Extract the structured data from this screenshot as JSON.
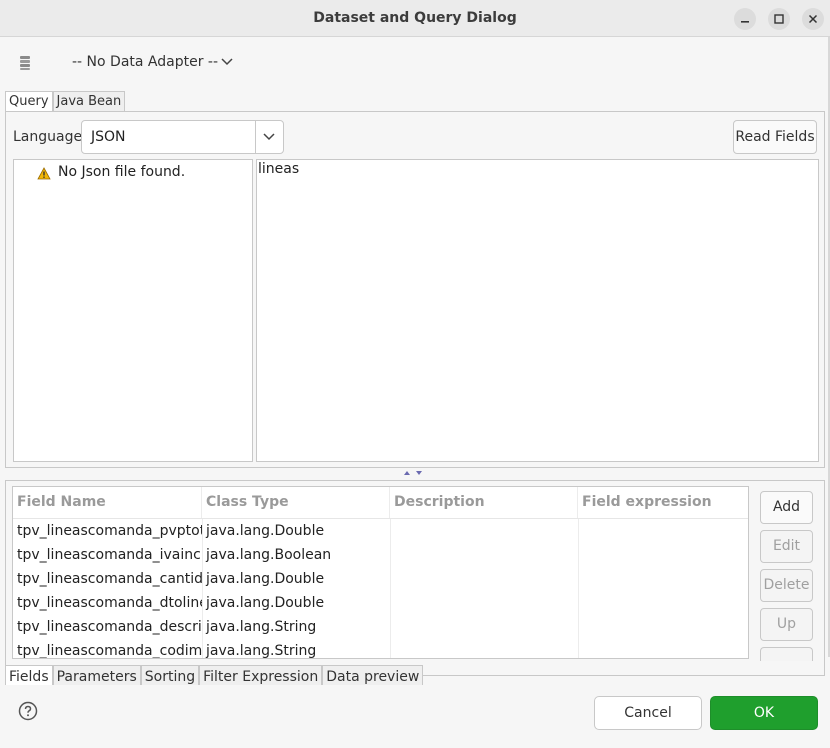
{
  "window": {
    "title": "Dataset and Query Dialog",
    "controls": [
      "minimize-icon",
      "maximize-icon",
      "close-icon"
    ]
  },
  "adapter": {
    "icon": "database-icon",
    "value": "-- No Data Adapter --"
  },
  "top_tabs": [
    {
      "label": "Query",
      "active": true
    },
    {
      "label": "Java Bean",
      "active": false
    }
  ],
  "query": {
    "language_label": "Language",
    "language_value": "JSON",
    "read_fields_label": "Read Fields",
    "tree_message": "No Json file found.",
    "query_text": "lineas"
  },
  "fields_table": {
    "columns": [
      "Field Name",
      "Class Type",
      "Description",
      "Field expression"
    ],
    "rows": [
      {
        "name": "tpv_lineascomanda_pvptot",
        "class": "java.lang.Double",
        "description": "",
        "expression": ""
      },
      {
        "name": "tpv_lineascomanda_ivaincl",
        "class": "java.lang.Boolean",
        "description": "",
        "expression": ""
      },
      {
        "name": "tpv_lineascomanda_cantida",
        "class": "java.lang.Double",
        "description": "",
        "expression": ""
      },
      {
        "name": "tpv_lineascomanda_dtoline",
        "class": "java.lang.Double",
        "description": "",
        "expression": ""
      },
      {
        "name": "tpv_lineascomanda_descrip",
        "class": "java.lang.String",
        "description": "",
        "expression": ""
      },
      {
        "name": "tpv_lineascomanda_codimp",
        "class": "java.lang.String",
        "description": "",
        "expression": ""
      }
    ]
  },
  "side_buttons": [
    {
      "label": "Add",
      "enabled": true
    },
    {
      "label": "Edit",
      "enabled": false
    },
    {
      "label": "Delete",
      "enabled": false
    },
    {
      "label": "Up",
      "enabled": false
    }
  ],
  "bottom_tabs": [
    {
      "label": "Fields",
      "active": true
    },
    {
      "label": "Parameters",
      "active": false
    },
    {
      "label": "Sorting",
      "active": false
    },
    {
      "label": "Filter Expression",
      "active": false
    },
    {
      "label": "Data preview",
      "active": false
    }
  ],
  "footer": {
    "help_icon": "help-icon",
    "cancel_label": "Cancel",
    "ok_label": "OK"
  },
  "colors": {
    "ok_button": "#1f9f2d",
    "warning_icon": "#f2b705"
  }
}
